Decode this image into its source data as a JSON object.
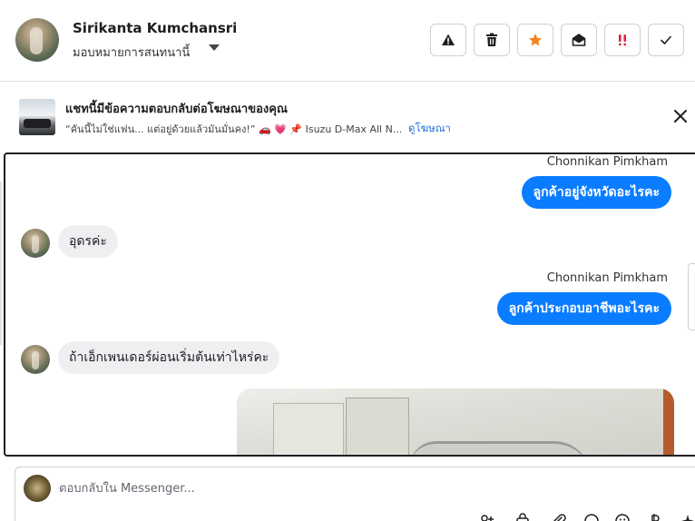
{
  "header": {
    "contact_name": "Sirikanta Kumchansri",
    "assign_label": "มอบหมายการสนทนานี้"
  },
  "actions": [
    {
      "name": "report-button",
      "icon": "warning-icon"
    },
    {
      "name": "delete-button",
      "icon": "trash-icon"
    },
    {
      "name": "star-button",
      "icon": "star-icon",
      "color": "#f5821f"
    },
    {
      "name": "mark-unread-button",
      "icon": "envelope-open-icon"
    },
    {
      "name": "priority-button",
      "icon": "exclamation-icon",
      "color": "#e41e3f"
    },
    {
      "name": "done-button",
      "icon": "check-icon"
    }
  ],
  "ad_banner": {
    "title": "แชทนี้มีข้อความตอบกลับต่อโฆษณาของคุณ",
    "preview": "“คันนี้ไม่ใช่แฟน... แต่อยู่ด้วยแล้วมันมั่นคง!” 🚗 💗 📌 Isuzu D-Max All N...",
    "link": "ดูโฆษณา"
  },
  "messages": [
    {
      "direction": "out",
      "sender": "Chonnikan Pimkham",
      "text": "ลูกค้าอยู่จังหวัดอะไรคะ"
    },
    {
      "direction": "in",
      "text": "อุดรค่ะ"
    },
    {
      "direction": "out",
      "sender": "Chonnikan Pimkham",
      "text": "ลูกค้าประกอบอาชีพอะไรคะ"
    },
    {
      "direction": "in",
      "text": "ถ้าเอ็กเพนเดอร์ผ่อนเริ่มต้นเท่าไหร่คะ"
    }
  ],
  "composer": {
    "placeholder": "ตอบกลับใน Messenger..."
  },
  "colors": {
    "outgoing_bubble": "#0a7cff",
    "incoming_bubble": "#eeeff1",
    "link": "#216fdb"
  }
}
